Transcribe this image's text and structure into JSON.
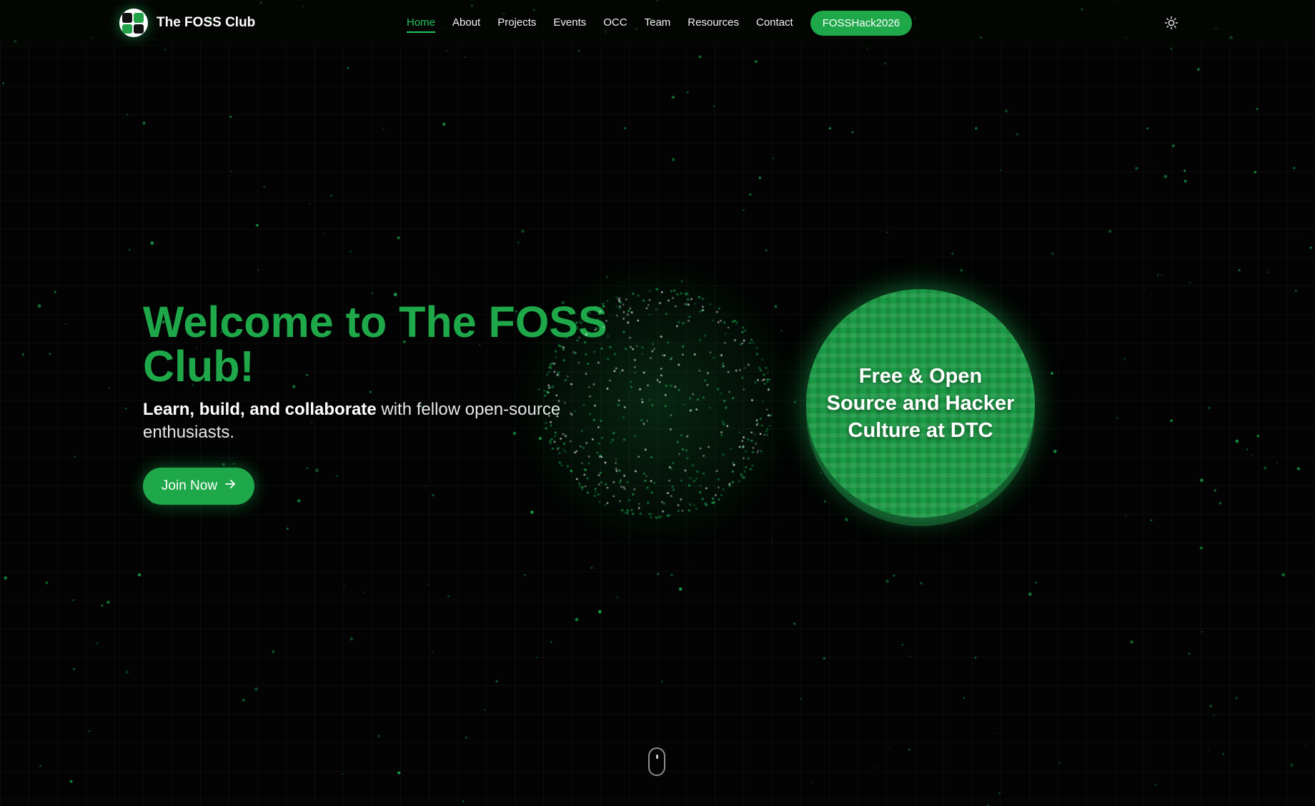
{
  "brand": {
    "name": "The FOSS Club",
    "logo_icon": "foss-club-logo"
  },
  "nav": {
    "items": [
      {
        "label": "Home",
        "active": true
      },
      {
        "label": "About",
        "active": false
      },
      {
        "label": "Projects",
        "active": false
      },
      {
        "label": "Events",
        "active": false
      },
      {
        "label": "OCC",
        "active": false
      },
      {
        "label": "Team",
        "active": false
      },
      {
        "label": "Resources",
        "active": false
      },
      {
        "label": "Contact",
        "active": false
      }
    ],
    "cta_label": "FOSSHack2026",
    "theme_toggle_icon": "sun-icon"
  },
  "hero": {
    "title": "Welcome to The FOSS Club!",
    "subtitle_bold": "Learn, build, and collaborate",
    "subtitle_rest": " with fellow open-source enthusiasts.",
    "join_label": "Join Now",
    "join_icon": "arrow-right-icon"
  },
  "disc": {
    "text": "Free & Open Source and Hacker Culture at DTC"
  },
  "scroll_icon": "mouse-scroll-icon",
  "colors": {
    "accent": "#1fa84a",
    "active_link": "#22c55e",
    "background": "#020302"
  }
}
